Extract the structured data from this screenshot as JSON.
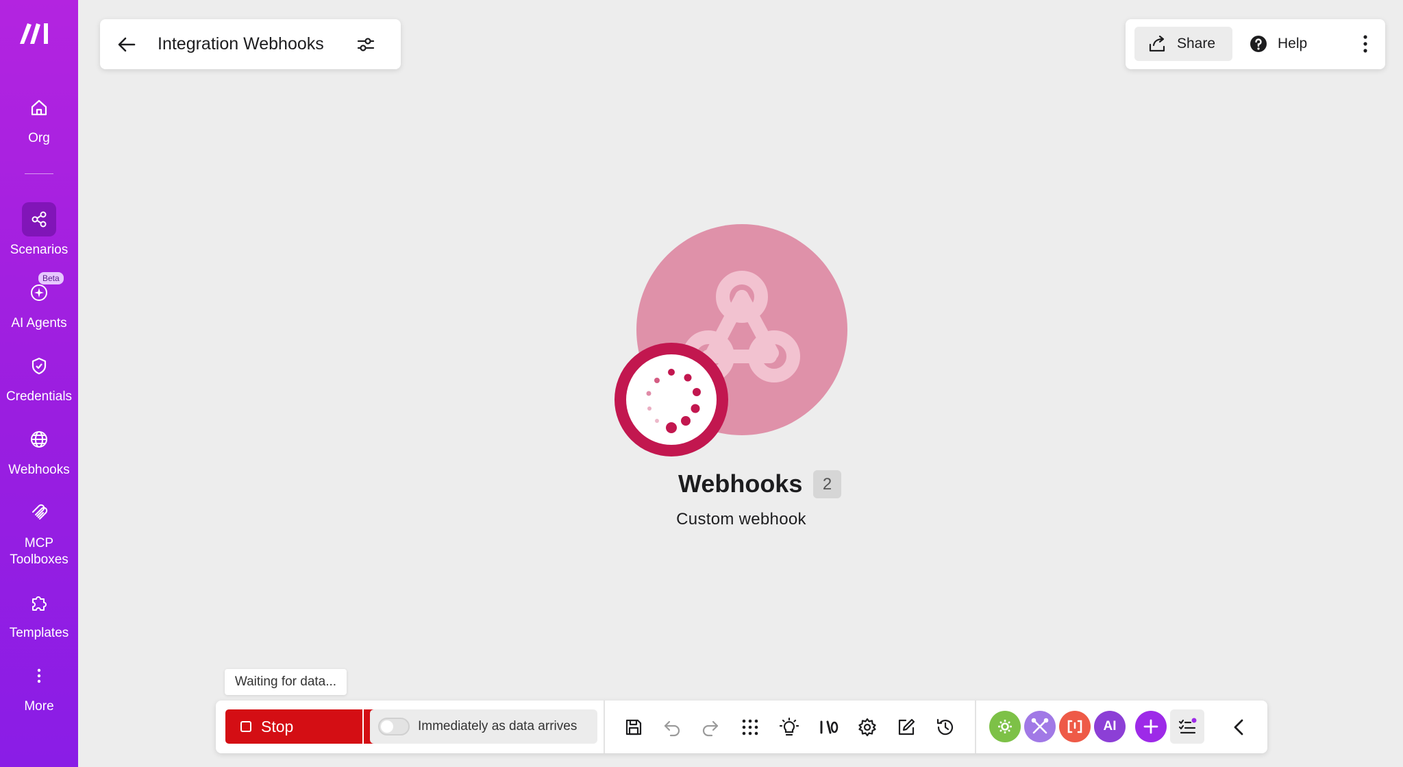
{
  "sidebar": {
    "logo_icon": "make-logo",
    "items": [
      {
        "label": "Org",
        "icon": "home-icon"
      },
      {
        "label": "Scenarios",
        "icon": "share-nodes-icon",
        "active": true
      },
      {
        "label": "AI Agents",
        "icon": "ai-agent-icon",
        "badge": "Beta"
      },
      {
        "label": "Credentials",
        "icon": "shield-check-icon"
      },
      {
        "label": "Webhooks",
        "icon": "globe-icon"
      },
      {
        "label": "MCP Toolboxes",
        "icon": "mcp-icon"
      },
      {
        "label": "Templates",
        "icon": "puzzle-icon"
      },
      {
        "label": "More",
        "icon": "kebab-vertical-icon"
      }
    ]
  },
  "header": {
    "title": "Integration Webhooks",
    "back_icon": "arrow-left-icon",
    "settings_icon": "sliders-icon"
  },
  "actions": {
    "share_label": "Share",
    "help_label": "Help"
  },
  "module": {
    "name": "Webhooks",
    "badge": "2",
    "subtitle": "Custom webhook",
    "color": "#df91a9",
    "status_color": "#c2174f"
  },
  "toolbar": {
    "tooltip": "Waiting for data...",
    "stop_label": "Stop",
    "schedule_label": "Immediately as data arrives",
    "stop_color": "#d40e14",
    "tools": [
      "save-icon",
      "undo-icon",
      "redo-icon",
      "grid-icon",
      "bulb-icon",
      "io-icon",
      "gear-icon",
      "notes-edit-icon",
      "history-icon"
    ],
    "apps": [
      {
        "name": "tools-app",
        "color": "#7dc147"
      },
      {
        "name": "flow-control-app",
        "color": "#a179e6"
      },
      {
        "name": "text-parser-app",
        "color": "#ee5a47"
      },
      {
        "name": "ai-app",
        "label": "AI",
        "color": "#8c3fd6"
      },
      {
        "name": "add-module",
        "color": "#9d2ae8"
      }
    ]
  }
}
